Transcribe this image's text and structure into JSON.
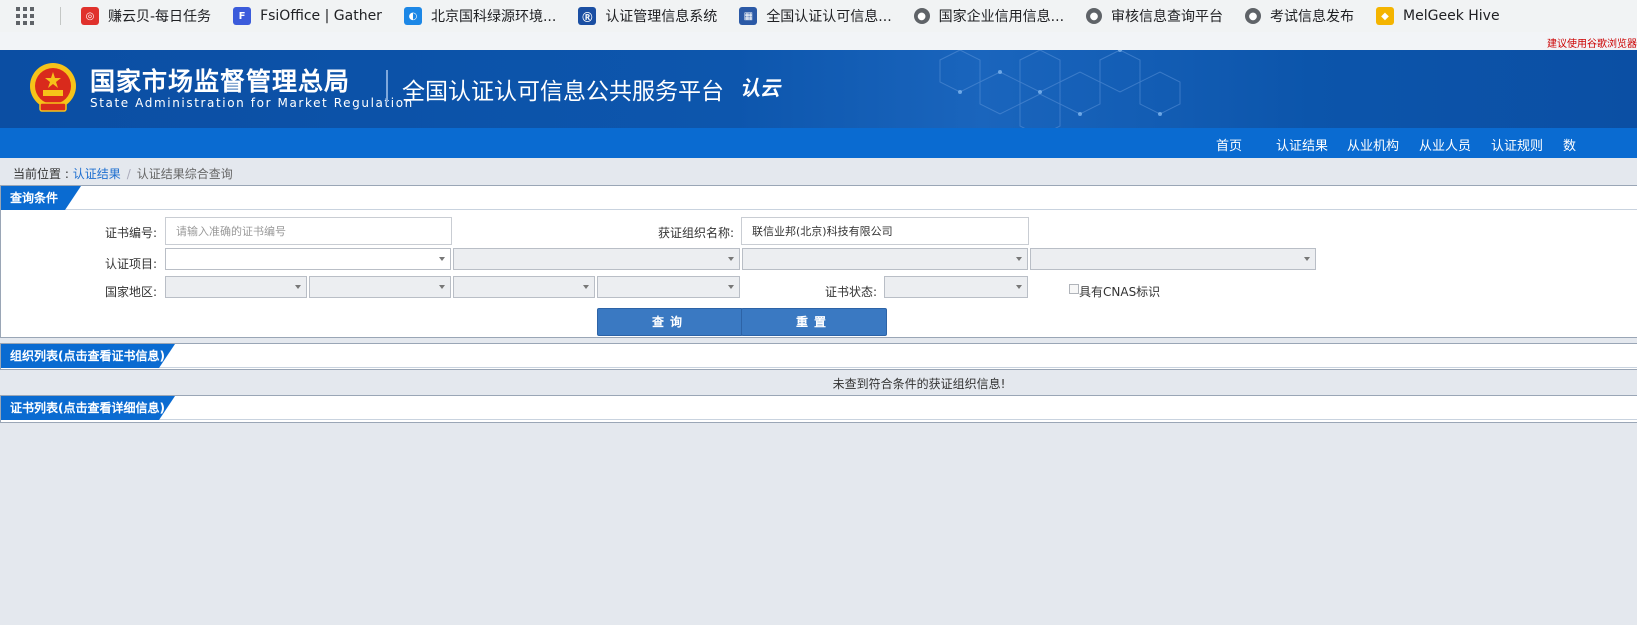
{
  "bookmarks": [
    {
      "label": "赚云贝-每日任务",
      "icon": "target-icon",
      "color": "#e0312c"
    },
    {
      "label": "FsiOffice | Gather",
      "icon": "fsi-icon",
      "color": "#3b5bdb"
    },
    {
      "label": "北京国科绿源环境...",
      "icon": "swirl-icon",
      "color": "#1c87e6"
    },
    {
      "label": "认证管理信息系统",
      "icon": "shield-icon",
      "color": "#1b4fa3"
    },
    {
      "label": "全国认证认可信息...",
      "icon": "building-icon",
      "color": "#2b59a6"
    },
    {
      "label": "国家企业信用信息...",
      "icon": "globe-icon",
      "color": "#5f6368"
    },
    {
      "label": "审核信息查询平台",
      "icon": "globe-icon",
      "color": "#5f6368"
    },
    {
      "label": "考试信息发布",
      "icon": "globe-icon",
      "color": "#5f6368"
    },
    {
      "label": "MelGeek Hive",
      "icon": "melgeek-icon",
      "color": "#f4b400"
    }
  ],
  "notice": "建议使用谷歌浏览器",
  "header": {
    "agency_cn": "国家市场监督管理总局",
    "agency_en": "State Administration  for  Market Regulation",
    "platform_title": "全国认证认可信息公共服务平台",
    "logo_text": "认云"
  },
  "nav": [
    "首页",
    "认证结果",
    "从业机构",
    "从业人员",
    "认证规则",
    "数"
  ],
  "breadcrumb": {
    "prefix": "当前位置 : ",
    "link": "认证结果",
    "separator": "/",
    "current": "认证结果综合查询"
  },
  "query": {
    "title": "查询条件",
    "cert_no_label": "证书编号:",
    "cert_no_placeholder": "请输入准确的证书编号",
    "cert_no_value": "",
    "org_name_label": "获证组织名称:",
    "org_name_value": "联信业邦(北京)科技有限公司",
    "project_label": "认证项目:",
    "region_label": "国家地区:",
    "status_label": "证书状态:",
    "cnas_label": "具有CNAS标识",
    "search_button": "查询",
    "reset_button": "重置"
  },
  "org_list": {
    "title": "组织列表(点击查看证书信息)",
    "empty_message": "未查到符合条件的获证组织信息!"
  },
  "cert_list": {
    "title": "证书列表(点击查看详细信息)"
  }
}
